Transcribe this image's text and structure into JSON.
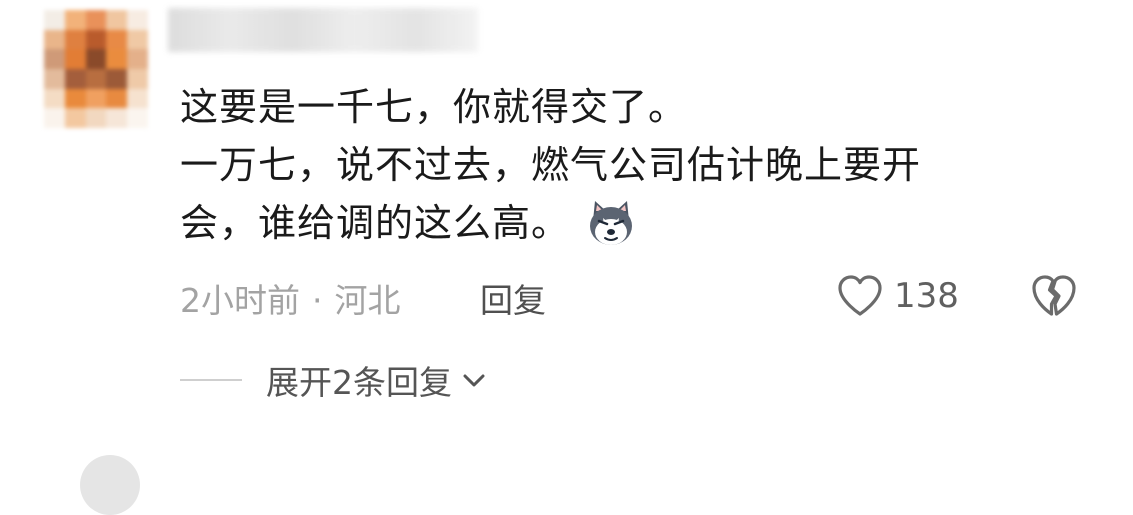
{
  "comment": {
    "lines": [
      "这要是一千七，你就得交了。",
      "一万七，说不过去，燃气公司估计晚上要开",
      "会，谁给调的这么高。"
    ],
    "emoji": "dog-face-emoji"
  },
  "meta": {
    "time": "2小时前",
    "separator": "·",
    "location": "河北",
    "reply_label": "回复"
  },
  "actions": {
    "like_icon": "heart-outline-icon",
    "like_count": "138",
    "dislike_icon": "broken-heart-icon"
  },
  "replies": {
    "expand_label": "展开2条回复",
    "expand_icon": "chevron-down-icon"
  },
  "colors": {
    "text_primary": "#1a1a1a",
    "text_meta": "#a3a3a3",
    "text_action": "#555555",
    "background": "#ffffff"
  }
}
